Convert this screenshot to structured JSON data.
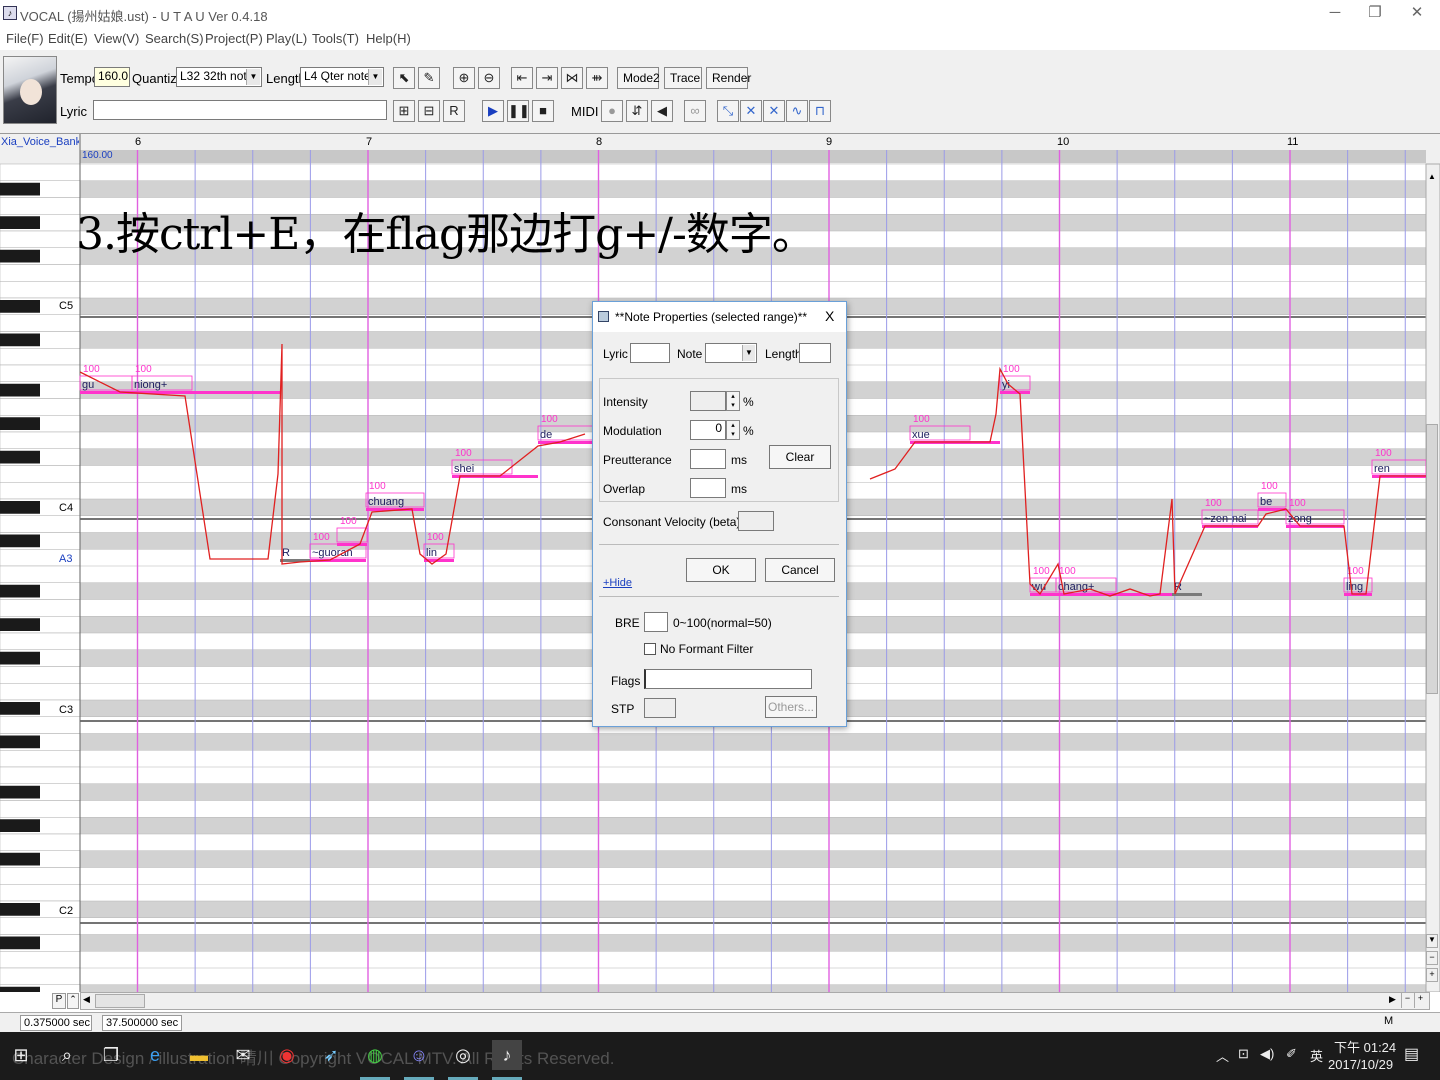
{
  "window": {
    "title": "VOCAL (揚州姑娘.ust) - U T A U Ver 0.4.18",
    "minimize": "─",
    "restore": "❐",
    "close": "✕"
  },
  "menu": [
    "File(F)",
    "Edit(E)",
    "View(V)",
    "Search(S)",
    "Project(P)",
    "Play(L)",
    "Tools(T)",
    "Help(H)"
  ],
  "toolbar": {
    "tempo_label": "Tempo",
    "tempo_value": "160.0",
    "quantize_label": "Quantize",
    "quantize_value": "L32 32th note",
    "length_label": "Length",
    "length_value": "L4  Qter note",
    "lyric_label": "Lyric",
    "lyric_value": "",
    "mode2": "Mode2",
    "trace": "Trace",
    "render": "Render",
    "midi": "MIDI"
  },
  "editor": {
    "voicebank": "Xia_Voice_Bank_",
    "tempo_marker": "160.00",
    "measures": [
      "6",
      "7",
      "8",
      "9",
      "10",
      "11"
    ],
    "pitch_labels": [
      "C5",
      "C4",
      "A3",
      "C3",
      "C2"
    ],
    "overlay_caption": "3.按ctrl+E，在flag那边打g+/-数字。",
    "notes": [
      {
        "lyric": "gu",
        "intensity": "100"
      },
      {
        "lyric": "niong+",
        "intensity": "100"
      },
      {
        "lyric": "R",
        "intensity": ""
      },
      {
        "lyric": "~guoran",
        "intensity": "100"
      },
      {
        "lyric": "",
        "intensity": "100"
      },
      {
        "lyric": "chuang",
        "intensity": "100"
      },
      {
        "lyric": "lin",
        "intensity": "100"
      },
      {
        "lyric": "shei",
        "intensity": "100"
      },
      {
        "lyric": "de",
        "intensity": "100"
      },
      {
        "lyric": "xue",
        "intensity": "100"
      },
      {
        "lyric": "yi",
        "intensity": "100"
      },
      {
        "lyric": "wu",
        "intensity": "100"
      },
      {
        "lyric": "chang+",
        "intensity": "100"
      },
      {
        "lyric": "R",
        "intensity": ""
      },
      {
        "lyric": "~zen-nai",
        "intensity": "100"
      },
      {
        "lyric": "be",
        "intensity": "100"
      },
      {
        "lyric": "zong",
        "intensity": "100"
      },
      {
        "lyric": "ling",
        "intensity": "100"
      },
      {
        "lyric": "ren",
        "intensity": "100"
      }
    ]
  },
  "dialog": {
    "title": "**Note Properties (selected range)**",
    "close": "X",
    "lyric_label": "Lyric",
    "note_label": "Note",
    "length_label": "Length",
    "intensity_label": "Intensity",
    "modulation_label": "Modulation",
    "modulation_value": "0",
    "percent": "%",
    "preutterance_label": "Preutterance",
    "overlap_label": "Overlap",
    "ms": "ms",
    "clear_button": "Clear",
    "consonant_label": "Consonant Velocity (beta)",
    "ok_button": "OK",
    "cancel_button": "Cancel",
    "hide_link": "+Hide",
    "bre_label": "BRE",
    "bre_hint": "0~100(normal=50)",
    "no_formant_label": "No Formant Filter",
    "flags_label": "Flags",
    "flags_value": "",
    "stp_label": "STP",
    "others_button": "Others..."
  },
  "status": {
    "time_a": "0.375000 sec",
    "time_b": "37.500000 sec",
    "mode": "M",
    "p": "P"
  },
  "taskbar": {
    "time": "下午 01:24",
    "date": "2017/10/29",
    "ime": "英",
    "watermark": "Character Design / illustration 晴川 Copyright VOCAL MTV. All Rights Reserved."
  },
  "colors": {
    "accent_pink": "#ff33cc",
    "pitch_red": "#e02020",
    "measure_line": "#e060e0",
    "beat_line": "#9a9ae8"
  }
}
